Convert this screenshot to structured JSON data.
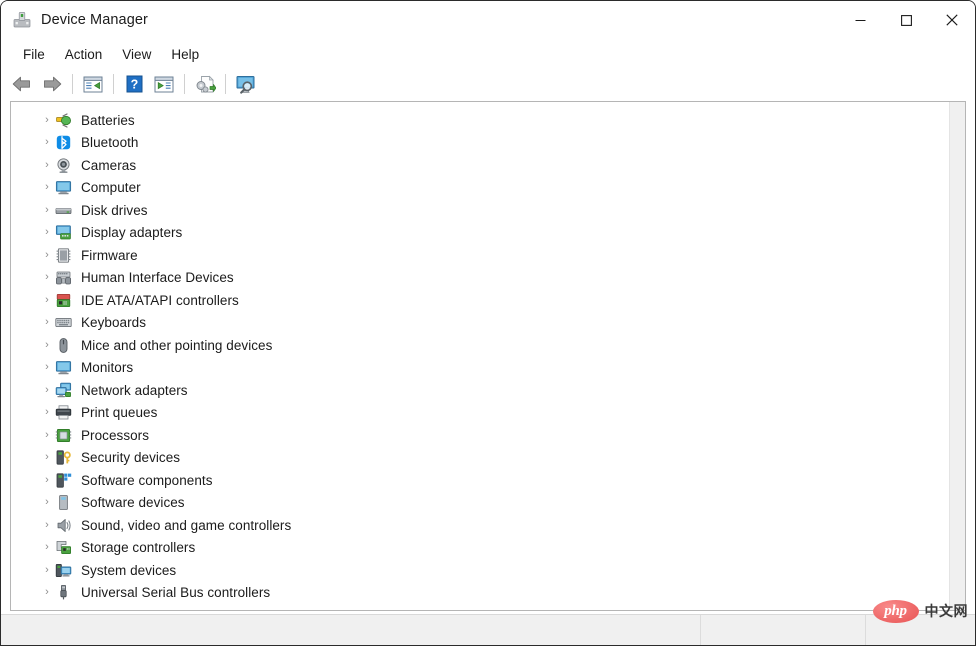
{
  "window": {
    "title": "Device Manager",
    "app_icon": "device-manager-icon",
    "caption": {
      "minimize_label": "Minimize",
      "minimize_icon": "minimize-icon",
      "maximize_label": "Maximize",
      "maximize_icon": "maximize-icon",
      "close_label": "Close",
      "close_icon": "close-icon"
    }
  },
  "menubar": {
    "items": [
      {
        "label": "File",
        "name": "menu-file"
      },
      {
        "label": "Action",
        "name": "menu-action"
      },
      {
        "label": "View",
        "name": "menu-view"
      },
      {
        "label": "Help",
        "name": "menu-help"
      }
    ]
  },
  "toolbar": {
    "buttons": [
      {
        "name": "back-button",
        "icon": "back-arrow-icon",
        "title": "Back"
      },
      {
        "name": "forward-button",
        "icon": "forward-arrow-icon",
        "title": "Forward"
      },
      {
        "name": "show-hide-console-tree-button",
        "icon": "console-tree-icon",
        "title": "Show/Hide Console Tree"
      },
      {
        "name": "help-button",
        "icon": "help-question-icon",
        "title": "Help"
      },
      {
        "name": "properties-button",
        "icon": "properties-window-icon",
        "title": "Properties"
      },
      {
        "name": "update-driver-button",
        "icon": "update-driver-icon",
        "title": "Update Driver Software"
      },
      {
        "name": "scan-hardware-changes-button",
        "icon": "scan-hardware-icon",
        "title": "Scan for hardware changes"
      }
    ]
  },
  "tree": {
    "expander_glyph": "›",
    "nodes": [
      {
        "label": "Batteries",
        "icon": "battery-icon"
      },
      {
        "label": "Bluetooth",
        "icon": "bluetooth-icon"
      },
      {
        "label": "Cameras",
        "icon": "camera-icon"
      },
      {
        "label": "Computer",
        "icon": "computer-icon"
      },
      {
        "label": "Disk drives",
        "icon": "disk-drive-icon"
      },
      {
        "label": "Display adapters",
        "icon": "display-adapter-icon"
      },
      {
        "label": "Firmware",
        "icon": "firmware-icon"
      },
      {
        "label": "Human Interface Devices",
        "icon": "hid-icon"
      },
      {
        "label": "IDE ATA/ATAPI controllers",
        "icon": "ide-controller-icon"
      },
      {
        "label": "Keyboards",
        "icon": "keyboard-icon"
      },
      {
        "label": "Mice and other pointing devices",
        "icon": "mouse-icon"
      },
      {
        "label": "Monitors",
        "icon": "monitor-icon"
      },
      {
        "label": "Network adapters",
        "icon": "network-adapter-icon"
      },
      {
        "label": "Print queues",
        "icon": "printer-icon"
      },
      {
        "label": "Processors",
        "icon": "processor-icon"
      },
      {
        "label": "Security devices",
        "icon": "security-device-icon"
      },
      {
        "label": "Software components",
        "icon": "software-component-icon"
      },
      {
        "label": "Software devices",
        "icon": "software-device-icon"
      },
      {
        "label": "Sound, video and game controllers",
        "icon": "sound-controller-icon"
      },
      {
        "label": "Storage controllers",
        "icon": "storage-controller-icon"
      },
      {
        "label": "System devices",
        "icon": "system-device-icon"
      },
      {
        "label": "Universal Serial Bus controllers",
        "icon": "usb-controller-icon"
      }
    ]
  },
  "statusbar": {
    "cell1_text": "",
    "cell2_text": "",
    "cell3_text": ""
  },
  "watermark": {
    "logo_text": "php",
    "site_text": "中文网"
  },
  "colors": {
    "accent_blue": "#0078d4",
    "bluetooth_blue": "#0e8ce6",
    "device_green": "#3f9e3f",
    "window_border": "#2b2b2b",
    "panel_border": "#b5b5b5",
    "statusbar_bg": "#f0f0f0",
    "watermark_red": "#ef6b6b"
  }
}
